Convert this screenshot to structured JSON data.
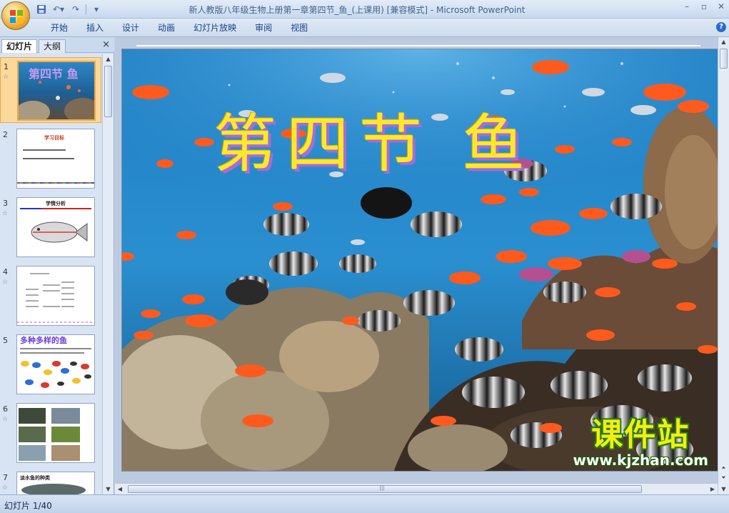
{
  "titlebar": {
    "title": "新人教版八年级生物上册第一章第四节_鱼_(上课用) [兼容模式] - Microsoft PowerPoint",
    "qat": [
      "save-icon",
      "undo-icon",
      "redo-icon",
      "customize-icon"
    ],
    "controls": [
      "minimize-icon",
      "maximize-icon",
      "close-icon"
    ]
  },
  "ribbon": {
    "tabs": [
      "开始",
      "插入",
      "设计",
      "动画",
      "幻灯片放映",
      "审阅",
      "视图"
    ]
  },
  "left_pane": {
    "tabs": [
      "幻灯片",
      "大纲"
    ],
    "close": "×",
    "thumbnails": [
      {
        "num": "1",
        "title": "第四节 鱼"
      },
      {
        "num": "2",
        "title": "学习目标"
      },
      {
        "num": "3",
        "title": "学情分析"
      },
      {
        "num": "4",
        "title": ""
      },
      {
        "num": "5",
        "title": "多种多样的鱼"
      },
      {
        "num": "6",
        "title": ""
      },
      {
        "num": "7",
        "title": "淡水鱼的种类"
      }
    ],
    "star": "☆"
  },
  "slide": {
    "title": "第四节  鱼",
    "watermark_main": "课件站",
    "watermark_url": "www.kjzhan.com"
  },
  "status": {
    "slide_indicator": "幻灯片 1/40"
  },
  "colors": {
    "ribbon_text": "#15428b",
    "selection": "#fcd89a",
    "title_yellow": "#ffe82a"
  }
}
